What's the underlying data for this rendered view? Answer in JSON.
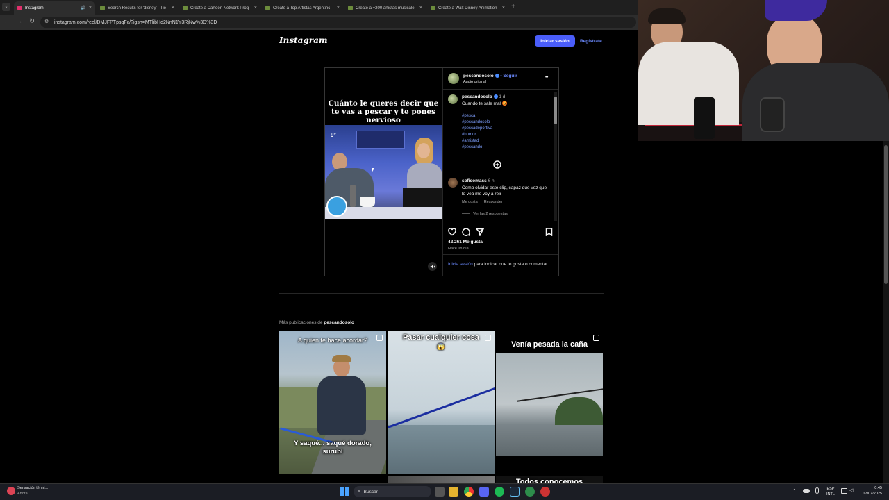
{
  "browser": {
    "tabs": [
      {
        "title": "Instagram",
        "color": "#e1306c",
        "active": true
      },
      {
        "title": "Search Results for 'disney' - Tie",
        "color": "#6c8c3c"
      },
      {
        "title": "Create a Cartoon Network Prog",
        "color": "#6c8c3c"
      },
      {
        "title": "Create a Top Artistas Argentinc",
        "color": "#6c8c3c"
      },
      {
        "title": "Create a +200 artistas musicale",
        "color": "#6c8c3c"
      },
      {
        "title": "Create a Walt Disney Animation",
        "color": "#6c8c3c"
      }
    ],
    "new_tab": "+",
    "url": "instagram.com/reel/DMJFPTpsqFc/?igsh=MTlibHd2NnN1Y3RjNw%3D%3D"
  },
  "header": {
    "logo": "Instagram",
    "login_label": "Iniciar sesión",
    "register_label": "Regístrate"
  },
  "post": {
    "overlay_caption": "Cuánto le queres decir que te vas a pescar y te pones nervioso",
    "username": "pescandosolo",
    "follow_label": "• Seguir",
    "audio": "Audio original",
    "more": "•••",
    "caption_user": "pescandosolo",
    "caption_time": "1 d",
    "caption_text": "Cuando te sale mal 😡",
    "hashtags": [
      "#pesca",
      "#pescandosolo",
      "#pescadeportiva",
      "#humor",
      "#amistad",
      "#pescando"
    ],
    "comment": {
      "user": "soficomass",
      "time": "6 h",
      "text": "Como olvidar este clip, capaz que vez que lo vea me voy a reír",
      "like_label": "Me gusta",
      "reply_label": "Responder",
      "view_replies": "Ver las 2 respuestas"
    },
    "likes": "42.261 Me gusta",
    "posted": "Hace un día",
    "login_prompt_link": "Inicia sesión",
    "login_prompt_text": " para indicar que te gusta o comentar."
  },
  "more_posts": {
    "label_prefix": "Más publicaciones de ",
    "label_user": "pescandosolo",
    "items": [
      {
        "top_caption": "A quien te hace acordar?",
        "bottom_caption": "Y saqué... saqué dorado, surubí"
      },
      {
        "top_caption": "Pasar cualquier cosa",
        "emoji": "😱"
      },
      {
        "top_caption": "Venía pesada la caña"
      }
    ],
    "partial_caption": "Todos conocemos"
  },
  "taskbar": {
    "notification_title": "Sensación térmi...",
    "notification_sub": "Ahora",
    "search_placeholder": "Buscar",
    "lang_top": "ESP",
    "lang_bottom": "INTL",
    "time": "0:45",
    "date": "17/07/2025"
  }
}
